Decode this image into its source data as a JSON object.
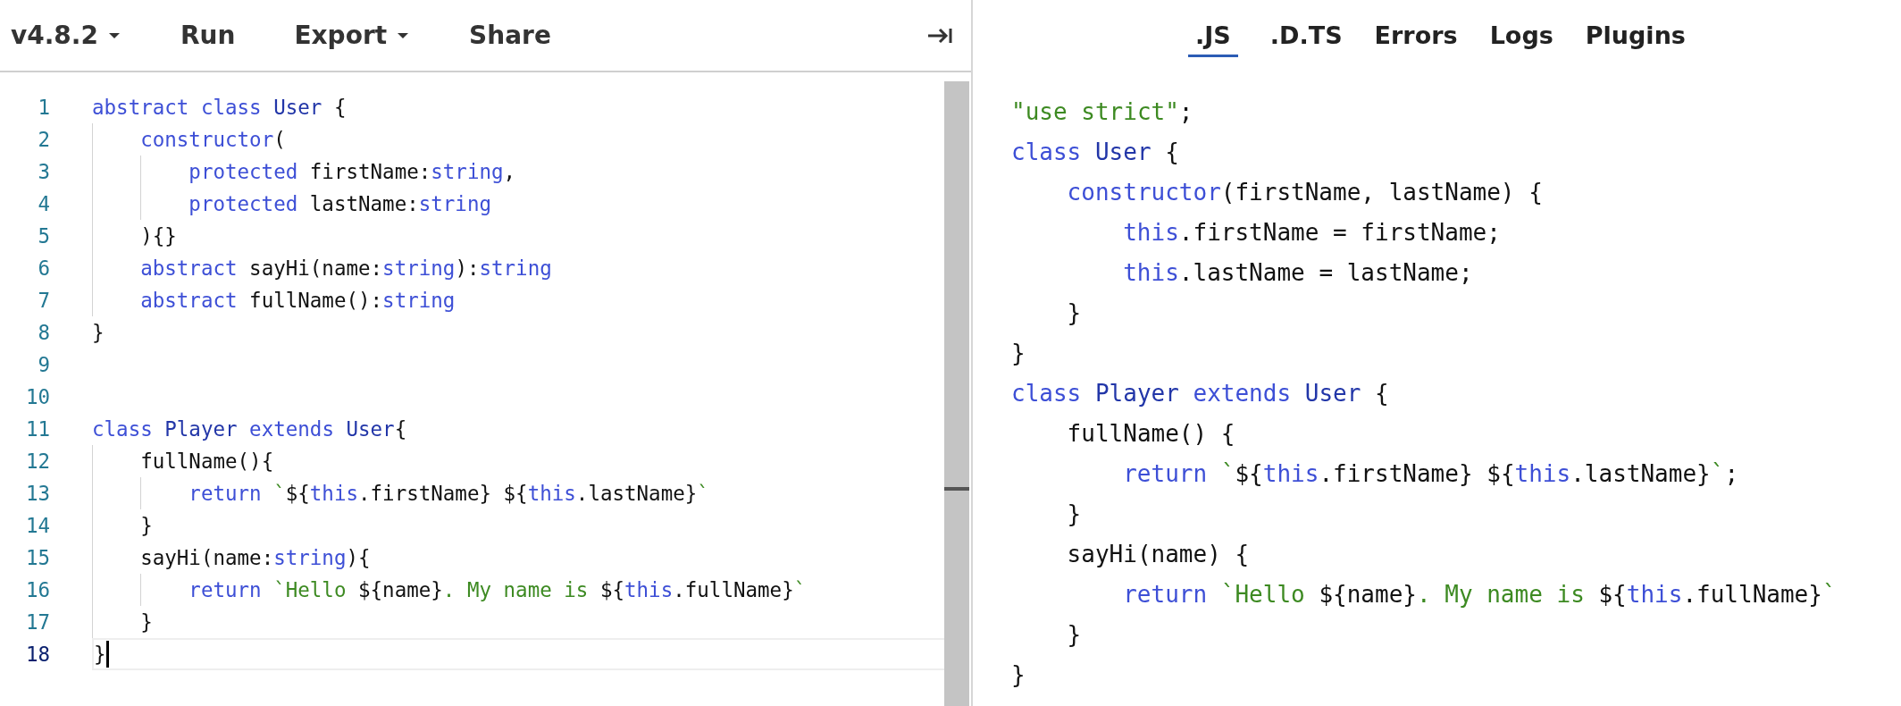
{
  "toolbar": {
    "version_menu": "v4.8.2",
    "buttons": [
      {
        "label": "Run",
        "kind": "button"
      },
      {
        "label": "Export",
        "kind": "menu"
      },
      {
        "label": "Share",
        "kind": "button"
      }
    ]
  },
  "editor": {
    "lines": [
      {
        "number": "1",
        "active": false,
        "tokens": [
          {
            "kind": "keyword",
            "text": "abstract class "
          },
          {
            "kind": "type",
            "text": "User"
          },
          {
            "kind": "plain",
            "text": " {"
          }
        ]
      },
      {
        "number": "2",
        "active": false,
        "tokens": [
          {
            "kind": "keyword",
            "text": "    constructor"
          },
          {
            "kind": "plain",
            "text": "("
          }
        ]
      },
      {
        "number": "3",
        "active": false,
        "tokens": [
          {
            "kind": "keyword",
            "text": "        protected"
          },
          {
            "kind": "plain",
            "text": " firstName:"
          },
          {
            "kind": "keyword",
            "text": "string"
          },
          {
            "kind": "plain",
            "text": ","
          }
        ]
      },
      {
        "number": "4",
        "active": false,
        "tokens": [
          {
            "kind": "keyword",
            "text": "        protected"
          },
          {
            "kind": "plain",
            "text": " lastName:"
          },
          {
            "kind": "keyword",
            "text": "string"
          }
        ]
      },
      {
        "number": "5",
        "active": false,
        "tokens": [
          {
            "kind": "plain",
            "text": "    ){}"
          }
        ]
      },
      {
        "number": "6",
        "active": false,
        "tokens": [
          {
            "kind": "keyword",
            "text": "    abstract"
          },
          {
            "kind": "plain",
            "text": " sayHi(name:"
          },
          {
            "kind": "keyword",
            "text": "string"
          },
          {
            "kind": "plain",
            "text": "):"
          },
          {
            "kind": "keyword",
            "text": "string"
          }
        ]
      },
      {
        "number": "7",
        "active": false,
        "tokens": [
          {
            "kind": "keyword",
            "text": "    abstract"
          },
          {
            "kind": "plain",
            "text": " fullName():"
          },
          {
            "kind": "keyword",
            "text": "string"
          }
        ]
      },
      {
        "number": "8",
        "active": false,
        "tokens": [
          {
            "kind": "plain",
            "text": "}"
          }
        ]
      },
      {
        "number": "9",
        "active": false
      },
      {
        "number": "10",
        "active": false
      },
      {
        "number": "11",
        "active": false,
        "tokens": [
          {
            "kind": "keyword",
            "text": "class "
          },
          {
            "kind": "type",
            "text": "Player"
          },
          {
            "kind": "keyword",
            "text": " extends "
          },
          {
            "kind": "type",
            "text": "User"
          },
          {
            "kind": "plain",
            "text": "{"
          }
        ]
      },
      {
        "number": "12",
        "active": false,
        "tokens": [
          {
            "kind": "plain",
            "text": "    fullName(){"
          }
        ]
      },
      {
        "number": "13",
        "active": false,
        "tokens": [
          {
            "kind": "keyword",
            "text": "        return "
          },
          {
            "kind": "string",
            "text": "`"
          },
          {
            "kind": "plain",
            "text": "${"
          },
          {
            "kind": "keyword",
            "text": "this"
          },
          {
            "kind": "plain",
            "text": ".firstName} ${"
          },
          {
            "kind": "keyword",
            "text": "this"
          },
          {
            "kind": "plain",
            "text": ".lastName}"
          },
          {
            "kind": "string",
            "text": "`"
          }
        ]
      },
      {
        "number": "14",
        "active": false,
        "tokens": [
          {
            "kind": "plain",
            "text": "    }"
          }
        ]
      },
      {
        "number": "15",
        "active": false,
        "tokens": [
          {
            "kind": "plain",
            "text": "    sayHi(name:"
          },
          {
            "kind": "keyword",
            "text": "string"
          },
          {
            "kind": "plain",
            "text": "){"
          }
        ]
      },
      {
        "number": "16",
        "active": false,
        "tokens": [
          {
            "kind": "keyword",
            "text": "        return "
          },
          {
            "kind": "string",
            "text": "`Hello "
          },
          {
            "kind": "plain",
            "text": "${name}"
          },
          {
            "kind": "string",
            "text": ". My name is "
          },
          {
            "kind": "plain",
            "text": "${"
          },
          {
            "kind": "keyword",
            "text": "this"
          },
          {
            "kind": "plain",
            "text": ".fullName}"
          },
          {
            "kind": "string",
            "text": "`"
          }
        ]
      },
      {
        "number": "17",
        "active": false,
        "tokens": [
          {
            "kind": "plain",
            "text": "    }"
          }
        ]
      },
      {
        "number": "18",
        "active": true,
        "tokens": [
          {
            "kind": "plain",
            "text": "}"
          }
        ]
      }
    ]
  },
  "output": {
    "tabs": [
      {
        "label": ".JS",
        "selected": true
      },
      {
        "label": ".D.TS",
        "selected": false
      },
      {
        "label": "Errors",
        "selected": false
      },
      {
        "label": "Logs",
        "selected": false
      },
      {
        "label": "Plugins",
        "selected": false
      }
    ],
    "lines": [
      {
        "tokens": [
          {
            "kind": "string",
            "text": "\"use strict\""
          },
          {
            "kind": "plain",
            "text": ";"
          }
        ]
      },
      {
        "tokens": [
          {
            "kind": "keyword",
            "text": "class "
          },
          {
            "kind": "type",
            "text": "User"
          },
          {
            "kind": "plain",
            "text": " {"
          }
        ]
      },
      {
        "tokens": [
          {
            "kind": "keyword",
            "text": "    constructor"
          },
          {
            "kind": "plain",
            "text": "(firstName, lastName) {"
          }
        ]
      },
      {
        "tokens": [
          {
            "kind": "keyword",
            "text": "        this"
          },
          {
            "kind": "plain",
            "text": ".firstName = firstName;"
          }
        ]
      },
      {
        "tokens": [
          {
            "kind": "keyword",
            "text": "        this"
          },
          {
            "kind": "plain",
            "text": ".lastName = lastName;"
          }
        ]
      },
      {
        "tokens": [
          {
            "kind": "plain",
            "text": "    }"
          }
        ]
      },
      {
        "tokens": [
          {
            "kind": "plain",
            "text": "}"
          }
        ]
      },
      {
        "tokens": [
          {
            "kind": "keyword",
            "text": "class "
          },
          {
            "kind": "type",
            "text": "Player"
          },
          {
            "kind": "keyword",
            "text": " extends "
          },
          {
            "kind": "type",
            "text": "User"
          },
          {
            "kind": "plain",
            "text": " {"
          }
        ]
      },
      {
        "tokens": [
          {
            "kind": "plain",
            "text": "    fullName() {"
          }
        ]
      },
      {
        "tokens": [
          {
            "kind": "keyword",
            "text": "        return "
          },
          {
            "kind": "string",
            "text": "`"
          },
          {
            "kind": "plain",
            "text": "${"
          },
          {
            "kind": "keyword",
            "text": "this"
          },
          {
            "kind": "plain",
            "text": ".firstName} ${"
          },
          {
            "kind": "keyword",
            "text": "this"
          },
          {
            "kind": "plain",
            "text": ".lastName}"
          },
          {
            "kind": "string",
            "text": "`"
          },
          {
            "kind": "plain",
            "text": ";"
          }
        ]
      },
      {
        "tokens": [
          {
            "kind": "plain",
            "text": "    }"
          }
        ]
      },
      {
        "tokens": [
          {
            "kind": "plain",
            "text": "    sayHi(name) {"
          }
        ]
      },
      {
        "tokens": [
          {
            "kind": "keyword",
            "text": "        return "
          },
          {
            "kind": "string",
            "text": "`Hello "
          },
          {
            "kind": "plain",
            "text": "${name}"
          },
          {
            "kind": "string",
            "text": ". My name is "
          },
          {
            "kind": "plain",
            "text": "${"
          },
          {
            "kind": "keyword",
            "text": "this"
          },
          {
            "kind": "plain",
            "text": ".fullName}"
          },
          {
            "kind": "string",
            "text": "`"
          }
        ]
      },
      {
        "tokens": [
          {
            "kind": "plain",
            "text": "    }"
          }
        ]
      },
      {
        "tokens": [
          {
            "kind": "plain",
            "text": "}"
          }
        ]
      }
    ]
  }
}
